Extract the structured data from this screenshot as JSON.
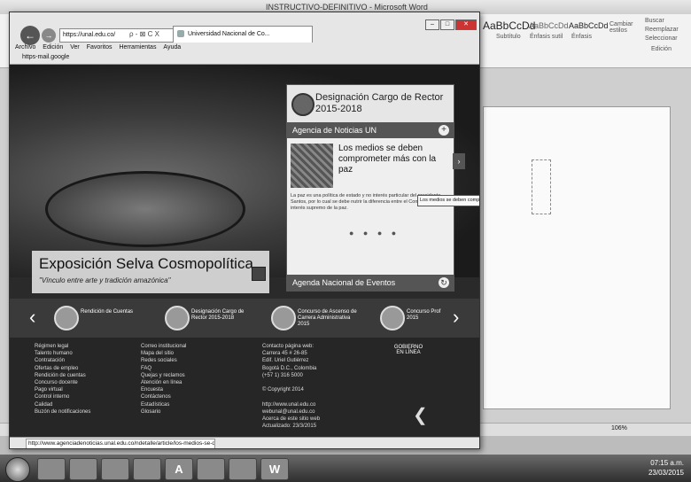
{
  "word": {
    "title": "INSTRUCTIVO-DEFINITIVO - Microsoft Word",
    "ribbon_styles": [
      "AaBbCcDd",
      "AaBbCcDd",
      "AaBbCcDd"
    ],
    "ribbon_style_names": [
      "Subtítulo",
      "Énfasis sutil",
      "Énfasis"
    ],
    "cambiar_estilos": "Cambiar estilos",
    "editing": [
      "Buscar",
      "Reemplazar",
      "Seleccionar"
    ],
    "editing_group": "Edición",
    "zoom": "106%"
  },
  "taskbar": {
    "buttons": [
      "",
      "",
      "",
      "",
      "A",
      "",
      "",
      "W"
    ],
    "time": "07:15 a.m.",
    "date": "23/03/2015"
  },
  "browser": {
    "address": "https://unal.edu.co/",
    "address_controls": "ρ - ⊠ C X",
    "tab_title": "Universidad Nacional de Co...",
    "menu": [
      "Archivo",
      "Edición",
      "Ver",
      "Favoritos",
      "Herramientas",
      "Ayuda"
    ],
    "favorite": "https-mail.google",
    "status_url": "http://www.agenciadenoticias.unal.edu.co/ndetalle/article/los-medios-se-deb..."
  },
  "page": {
    "hero_title": "Exposición Selva Cosmopolítica",
    "hero_subtitle": "\"Vínculo entre arte y tradición amazónica\"",
    "designacion": "Designación Cargo de Rector 2015-2018",
    "agencia": "Agencia de Noticias UN",
    "news_headline": "Los medios se deben comprometer más con la paz",
    "news_body": "La paz es una política de estado y no interés particular del presidente Santos, por lo cual se debe nutrir la diferencia entre el Congreso y el interés supremo de la paz.",
    "tooltip": "Los medios se deben comprometer más con la paz",
    "agenda": "Agenda Nacional de Eventos",
    "carousel": [
      "Rendición de Cuentas",
      "Designación Cargo de Rector 2015-2018",
      "Concurso de Ascenso de Carrera Administrativa 2015",
      "Concurso Prof 2015"
    ],
    "footer_col1": [
      "Régimen legal",
      "Talento humano",
      "Contratación",
      "Ofertas de empleo",
      "Rendición de cuentas",
      "Concurso docente",
      "Pago virtual",
      "Control interno",
      "Calidad",
      "Buzón de notificaciones"
    ],
    "footer_col2": [
      "Correo institucional",
      "Mapa del sitio",
      "Redes sociales",
      "FAQ",
      "Quejas y reclamos",
      "Atención en línea",
      "Encuesta",
      "Contáctenos",
      "Estadísticas",
      "Glosario"
    ],
    "footer_col3": [
      "Contacto página web:",
      "Carrera 45 # 26-85",
      "Edif. Uriel Gutiérrez",
      "Bogotá D.C., Colombia",
      "(+57 1) 316 5000",
      "",
      "© Copyright 2014",
      "",
      "http://www.unal.edu.co",
      "webunal@unal.edu.co",
      "Acerca de este sitio web",
      "Actualizado: 23/3/2015"
    ],
    "footer_logo": "GOBIERNO EN LÍNEA"
  }
}
